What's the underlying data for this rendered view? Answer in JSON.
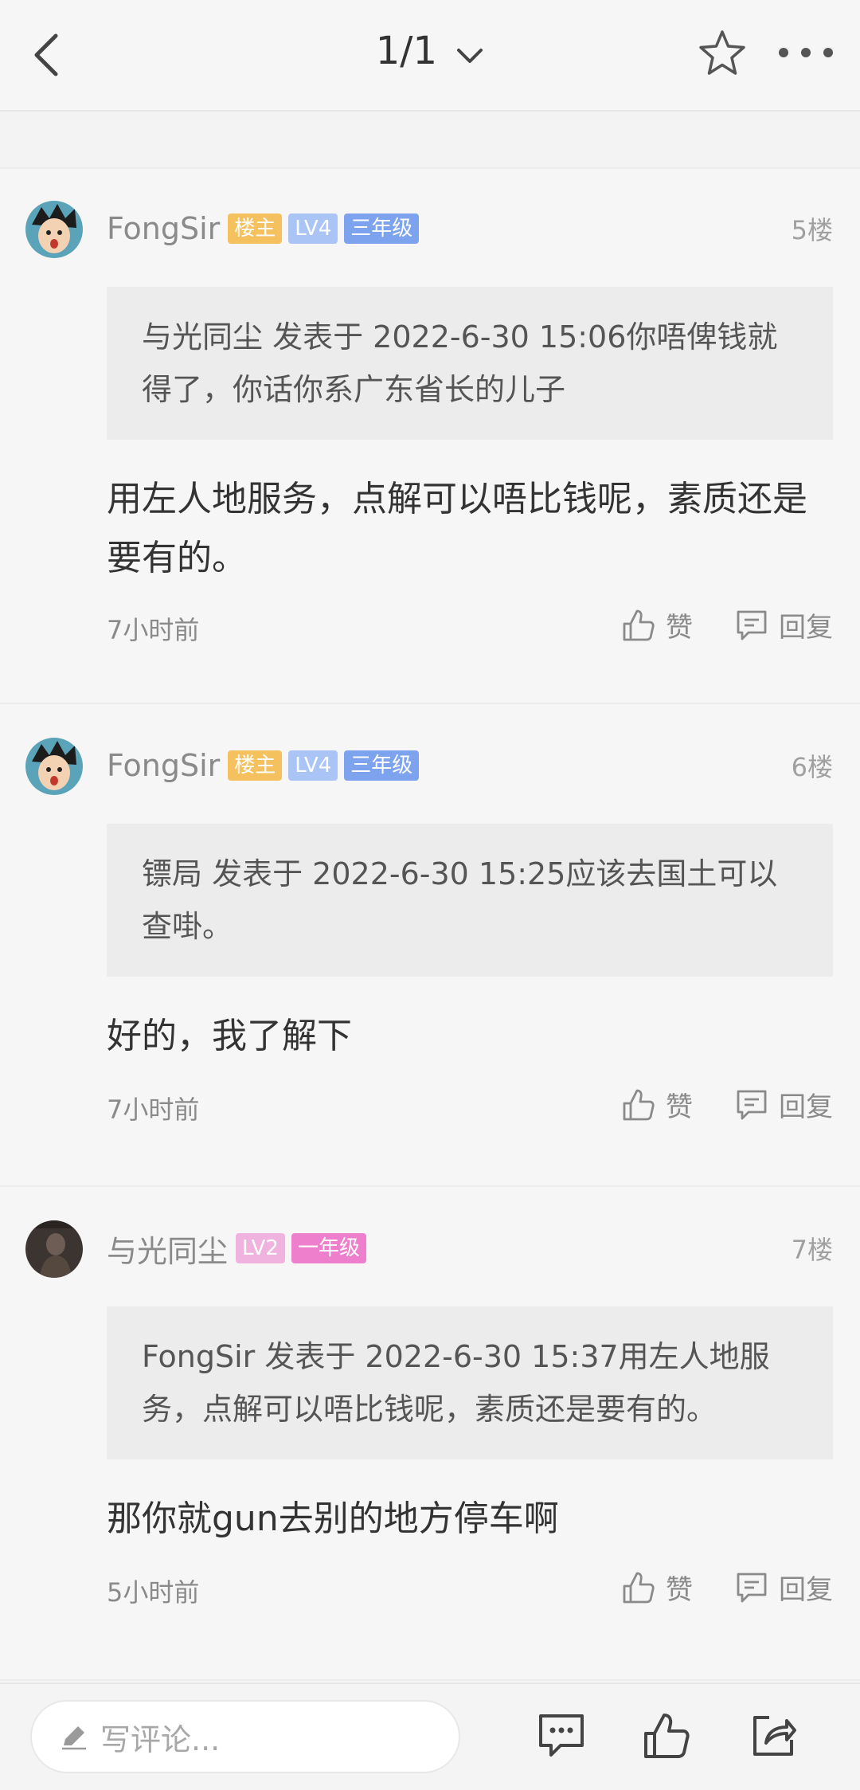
{
  "header": {
    "page_indicator": "1/1"
  },
  "posts": [
    {
      "username": "FongSir",
      "badges": [
        {
          "text": "楼主",
          "color": "#f5c15e"
        },
        {
          "text": "LV4",
          "color": "#a9c4f5"
        },
        {
          "text": "三年级",
          "color": "#7ea3ee"
        }
      ],
      "floor": "5楼",
      "quote": "与光同尘 发表于 2022-6-30 15:06你唔俾钱就得了，你话你系广东省长的儿子",
      "content": "用左人地服务，点解可以唔比钱呢，素质还是要有的。",
      "time": "7小时前",
      "like_label": "赞",
      "reply_label": "回复"
    },
    {
      "username": "FongSir",
      "badges": [
        {
          "text": "楼主",
          "color": "#f5c15e"
        },
        {
          "text": "LV4",
          "color": "#a9c4f5"
        },
        {
          "text": "三年级",
          "color": "#7ea3ee"
        }
      ],
      "floor": "6楼",
      "quote": "镖局 发表于 2022-6-30 15:25应该去国土可以查啩。",
      "content": "好的，我了解下",
      "time": "7小时前",
      "like_label": "赞",
      "reply_label": "回复"
    },
    {
      "username": "与光同尘",
      "badges": [
        {
          "text": "LV2",
          "color": "#f0b3e0"
        },
        {
          "text": "一年级",
          "color": "#ee7fcc"
        }
      ],
      "floor": "7楼",
      "quote": "FongSir 发表于 2022-6-30 15:37用左人地服务，点解可以唔比钱呢，素质还是要有的。",
      "content": "那你就gun去别的地方停车啊",
      "time": "5小时前",
      "like_label": "赞",
      "reply_label": "回复"
    }
  ],
  "bottom": {
    "comment_placeholder": "写评论..."
  }
}
